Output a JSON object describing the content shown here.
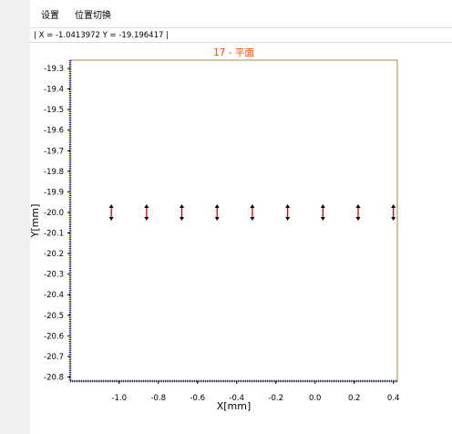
{
  "menu": {
    "settings_label": "设置",
    "position_switch_label": "位置切换"
  },
  "status": {
    "coords_text": "| X = -1.0413972  Y = -19.196417 |"
  },
  "colors": {
    "title": "#ff4500",
    "frame": "#b08a3a",
    "axis_line": "#2a2a7a",
    "marker_red": "#dd0000",
    "marker_black": "#000000"
  },
  "chart_data": {
    "type": "scatter",
    "title": "17 - 平面",
    "xlabel": "X[mm]",
    "ylabel": "Y[mm]",
    "xlim": [
      -1.25,
      0.42
    ],
    "ylim": [
      -20.82,
      -19.26
    ],
    "xticks": [
      "-1.0",
      "-0.8",
      "-0.6",
      "-0.4",
      "-0.2",
      "0.0",
      "0.2",
      "0.4"
    ],
    "xtick_values": [
      -1.0,
      -0.8,
      -0.6,
      -0.4,
      -0.2,
      0.0,
      0.2,
      0.4
    ],
    "yticks": [
      "-19.3",
      "-19.4",
      "-19.5",
      "-19.6",
      "-19.7",
      "-19.8",
      "-19.9",
      "-20.0",
      "-20.1",
      "-20.2",
      "-20.3",
      "-20.4",
      "-20.5",
      "-20.6",
      "-20.7",
      "-20.8"
    ],
    "ytick_values": [
      -19.3,
      -19.4,
      -19.5,
      -19.6,
      -19.7,
      -19.8,
      -19.9,
      -20.0,
      -20.1,
      -20.2,
      -20.3,
      -20.4,
      -20.5,
      -20.6,
      -20.7,
      -20.8
    ],
    "points": {
      "x": [
        -1.04,
        -0.86,
        -0.68,
        -0.5,
        -0.32,
        -0.14,
        0.04,
        0.22,
        0.4
      ],
      "y": [
        -20.0,
        -20.0,
        -20.0,
        -20.0,
        -20.0,
        -20.0,
        -20.0,
        -20.0,
        -20.0
      ]
    },
    "marker": "double-arrow-vertical"
  }
}
